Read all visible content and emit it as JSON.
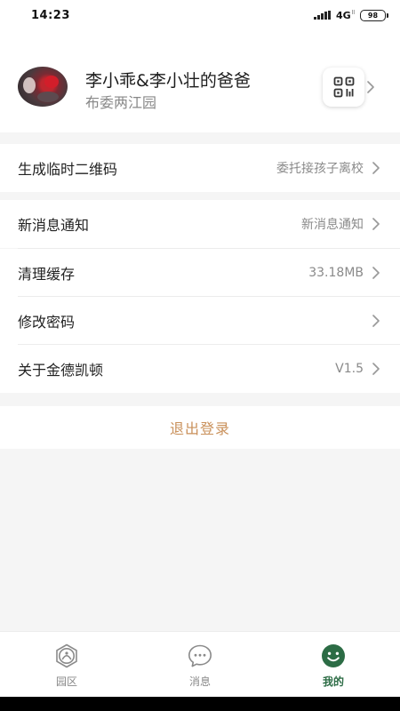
{
  "status_bar": {
    "time": "14:23",
    "network": "4G",
    "network_sub": "ll",
    "battery": "98"
  },
  "profile": {
    "name": "李小乖&李小壮的爸爸",
    "school": "布委两江园"
  },
  "menu": {
    "qr_code": {
      "label": "生成临时二维码",
      "value": "委托接孩子离校"
    },
    "notifications": {
      "label": "新消息通知",
      "value": "新消息通知"
    },
    "clear_cache": {
      "label": "清理缓存",
      "value": "33.18MB"
    },
    "change_password": {
      "label": "修改密码",
      "value": ""
    },
    "about": {
      "label": "关于金德凯顿",
      "value": "V1.5"
    }
  },
  "logout": {
    "label": "退出登录"
  },
  "tabs": [
    {
      "label": "园区",
      "icon": "campus-icon",
      "active": false
    },
    {
      "label": "消息",
      "icon": "message-icon",
      "active": false
    },
    {
      "label": "我的",
      "icon": "profile-icon",
      "active": true
    }
  ],
  "colors": {
    "accent_green": "#2c6c45",
    "logout_text": "#c9905a"
  }
}
